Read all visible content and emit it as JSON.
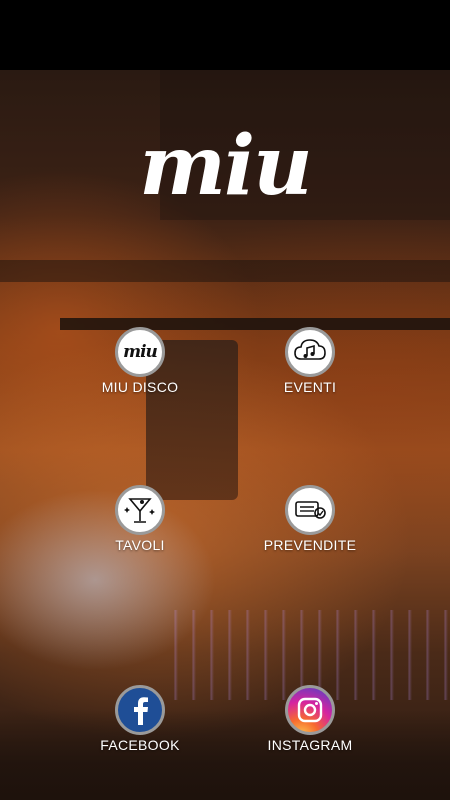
{
  "app": {
    "logo_text": "miu"
  },
  "menu": {
    "items": [
      {
        "id": "miu-disco",
        "label": "MIU DISCO",
        "icon": "miu-logo-icon"
      },
      {
        "id": "eventi",
        "label": "EVENTI",
        "icon": "music-cloud-icon"
      },
      {
        "id": "tavoli",
        "label": "TAVOLI",
        "icon": "cocktail-icon"
      },
      {
        "id": "prevendite",
        "label": "PREVENDITE",
        "icon": "tickets-icon"
      },
      {
        "id": "facebook",
        "label": "FACEBOOK",
        "icon": "facebook-icon"
      },
      {
        "id": "instagram",
        "label": "INSTAGRAM",
        "icon": "instagram-icon"
      }
    ]
  },
  "colors": {
    "facebook": "#1f4e96",
    "icon_border": "#9a9a9a",
    "label": "#ffffff"
  }
}
